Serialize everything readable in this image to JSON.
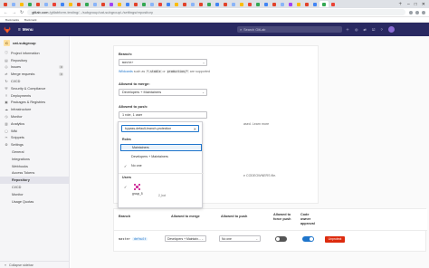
{
  "browser": {
    "url_host": "gitlab.com",
    "url_path": "/gitlabform-testing/.../subgroup/cat-subgroup/-/settings/repository",
    "bookmarks": [
      "Bookmarks",
      "Bookmark"
    ],
    "tab_colors": [
      "#e2432a",
      "#8ab4f8",
      "#fbbc04",
      "#34a853",
      "#e2432a",
      "#8ab4f8",
      "#ea4335",
      "#4285f4",
      "#fbbc04",
      "#e2432a",
      "#34a853",
      "#8ab4f8",
      "#e2432a",
      "#a142f4",
      "#fbbc04",
      "#4285f4",
      "#e2432a",
      "#34a853",
      "#8ab4f8",
      "#ea4335",
      "#4285f4",
      "#fbbc04",
      "#e2432a",
      "#8ab4f8",
      "#e2432a",
      "#34a853",
      "#4285f4",
      "#e2432a",
      "#8ab4f8",
      "#fbbc04",
      "#ea4335",
      "#34a853",
      "#4285f4",
      "#e2432a",
      "#8ab4f8",
      "#a142f4",
      "#fbbc04",
      "#e2432a",
      "#4285f4",
      "#34a853",
      "#ea4335"
    ]
  },
  "header": {
    "menu_label": "Menu",
    "search_placeholder": "Search GitLab",
    "icons": [
      "plus-icon",
      "issues-icon",
      "merge-requests-icon",
      "todo-icon",
      "help-icon"
    ]
  },
  "sidebar": {
    "project_initial": "C",
    "project_name": "cat-subgroup",
    "items": [
      {
        "label": "Project information",
        "icon": "ⓘ"
      },
      {
        "label": "Repository",
        "icon": "▤"
      },
      {
        "label": "Issues",
        "icon": "◎",
        "badge": "0"
      },
      {
        "label": "Merge requests",
        "icon": "⇄",
        "badge": "0"
      },
      {
        "label": "CI/CD",
        "icon": "↻"
      },
      {
        "label": "Security & Compliance",
        "icon": "⛨"
      },
      {
        "label": "Deployments",
        "icon": "⇪"
      },
      {
        "label": "Packages & Registries",
        "icon": "▣"
      },
      {
        "label": "Infrastructure",
        "icon": "☁"
      },
      {
        "label": "Monitor",
        "icon": "◷"
      },
      {
        "label": "Analytics",
        "icon": "▥"
      },
      {
        "label": "Wiki",
        "icon": "▢"
      },
      {
        "label": "Snippets",
        "icon": "✂"
      },
      {
        "label": "Settings",
        "icon": "⚙"
      }
    ],
    "settings_sub": [
      "General",
      "Integrations",
      "Webhooks",
      "Access Tokens",
      "Repository",
      "CI/CD",
      "Monitor",
      "Usage Quotas"
    ],
    "collapse_label": "Collapse sidebar"
  },
  "form": {
    "branch_label": "Branch:",
    "branch_value": "master",
    "wildcards_link": "Wildcards",
    "wildcards_text_1": " such as ",
    "wildcard_1": "*-stable",
    "wildcards_or": " or ",
    "wildcard_2": "production/*",
    "wildcards_text_2": " are supported",
    "merge_label": "Allowed to merge:",
    "merge_value": "Developers + Maintainers",
    "push_label": "Allowed to push:",
    "push_value": "1 role, 1 user",
    "frag_learn": "ased. Learn more",
    "frag_codeowners": "e CODEOWNERS file."
  },
  "dropdown": {
    "search_value": "bypass-default-branch-protection",
    "roles_header": "Roles",
    "roles": [
      {
        "label": "Maintainers",
        "checked": false,
        "highlighted": true
      },
      {
        "label": "Developers + Maintainers",
        "checked": false,
        "highlighted": false
      },
      {
        "label": "No one",
        "checked": true,
        "highlighted": false
      }
    ],
    "users_header": "Users",
    "user_name": "group_5",
    "user_handle": "2_bot"
  },
  "table": {
    "headers": [
      "Branch",
      "Allowed to merge",
      "Allowed to push",
      "Allowed to force push",
      "Code owner approval"
    ],
    "row": {
      "branch": "master",
      "badge": "default",
      "merge": "Developers + Maintain...",
      "push": "No one",
      "force_push": false,
      "code_owner": true,
      "action": "Unprotect"
    }
  },
  "colors": {
    "header_bg": "#292961",
    "link": "#1f75cb",
    "danger": "#dd2b0e"
  }
}
